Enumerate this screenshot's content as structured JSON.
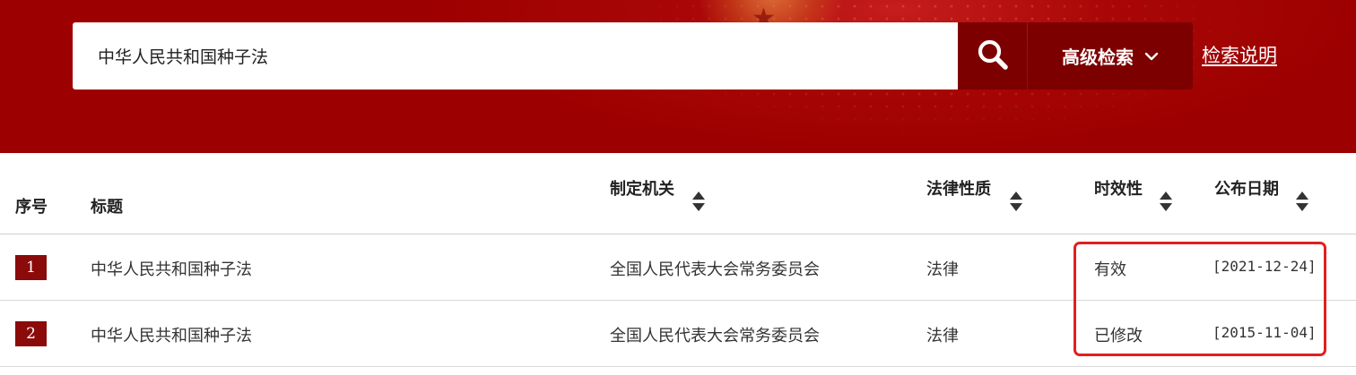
{
  "search": {
    "query": "中华人民共和国种子法",
    "search_icon": "search-icon",
    "advanced_label": "高级检索",
    "advanced_icon": "chevron-down-icon",
    "help_label": "检索说明"
  },
  "colors": {
    "banner": "#9d0000",
    "button": "#7d0000",
    "badge": "#8b0a0a",
    "highlight": "#e02020"
  },
  "table": {
    "columns": {
      "index": "序号",
      "title": "标题",
      "authority": "制定机关",
      "nature": "法律性质",
      "validity": "时效性",
      "date": "公布日期"
    },
    "sort_icon": "sort-icon",
    "rows": [
      {
        "index": "1",
        "title": "中华人民共和国种子法",
        "authority": "全国人民代表大会常务委员会",
        "nature": "法律",
        "validity": "有效",
        "date": "[2021-12-24]"
      },
      {
        "index": "2",
        "title": "中华人民共和国种子法",
        "authority": "全国人民代表大会常务委员会",
        "nature": "法律",
        "validity": "已修改",
        "date": "[2015-11-04]"
      }
    ]
  }
}
